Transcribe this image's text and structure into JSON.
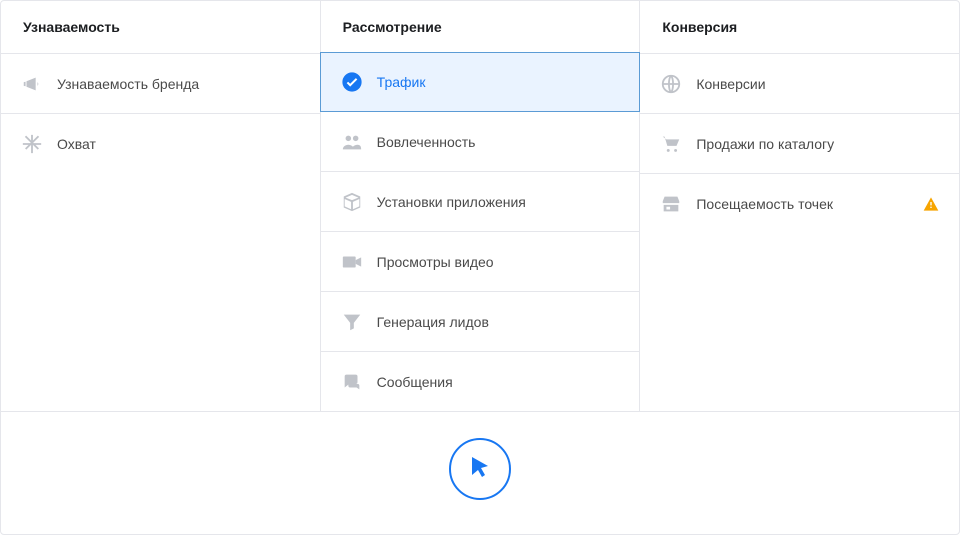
{
  "columns": [
    {
      "header": "Узнаваемость",
      "items": [
        {
          "id": "brand-awareness",
          "label": "Узнаваемость бренда",
          "icon": "megaphone-icon",
          "selected": false,
          "warning": false
        },
        {
          "id": "reach",
          "label": "Охват",
          "icon": "snowflake-icon",
          "selected": false,
          "warning": false
        }
      ]
    },
    {
      "header": "Рассмотрение",
      "items": [
        {
          "id": "traffic",
          "label": "Трафик",
          "icon": "check-circle-icon",
          "selected": true,
          "warning": false
        },
        {
          "id": "engagement",
          "label": "Вовлеченность",
          "icon": "people-icon",
          "selected": false,
          "warning": false
        },
        {
          "id": "app-installs",
          "label": "Установки приложения",
          "icon": "box-icon",
          "selected": false,
          "warning": false
        },
        {
          "id": "video-views",
          "label": "Просмотры видео",
          "icon": "video-icon",
          "selected": false,
          "warning": false
        },
        {
          "id": "lead-gen",
          "label": "Генерация лидов",
          "icon": "funnel-icon",
          "selected": false,
          "warning": false
        },
        {
          "id": "messages",
          "label": "Сообщения",
          "icon": "chat-icon",
          "selected": false,
          "warning": false
        }
      ]
    },
    {
      "header": "Конверсия",
      "items": [
        {
          "id": "conversions",
          "label": "Конверсии",
          "icon": "globe-icon",
          "selected": false,
          "warning": false
        },
        {
          "id": "catalog-sales",
          "label": "Продажи по каталогу",
          "icon": "cart-icon",
          "selected": false,
          "warning": false
        },
        {
          "id": "store-visits",
          "label": "Посещаемость точек",
          "icon": "store-icon",
          "selected": false,
          "warning": true
        }
      ]
    }
  ],
  "colors": {
    "accent": "#1877f2",
    "muted": "#c0c3c9",
    "selected_bg": "#eaf3ff",
    "border": "#e5e6eb",
    "warning": "#f7a500"
  }
}
